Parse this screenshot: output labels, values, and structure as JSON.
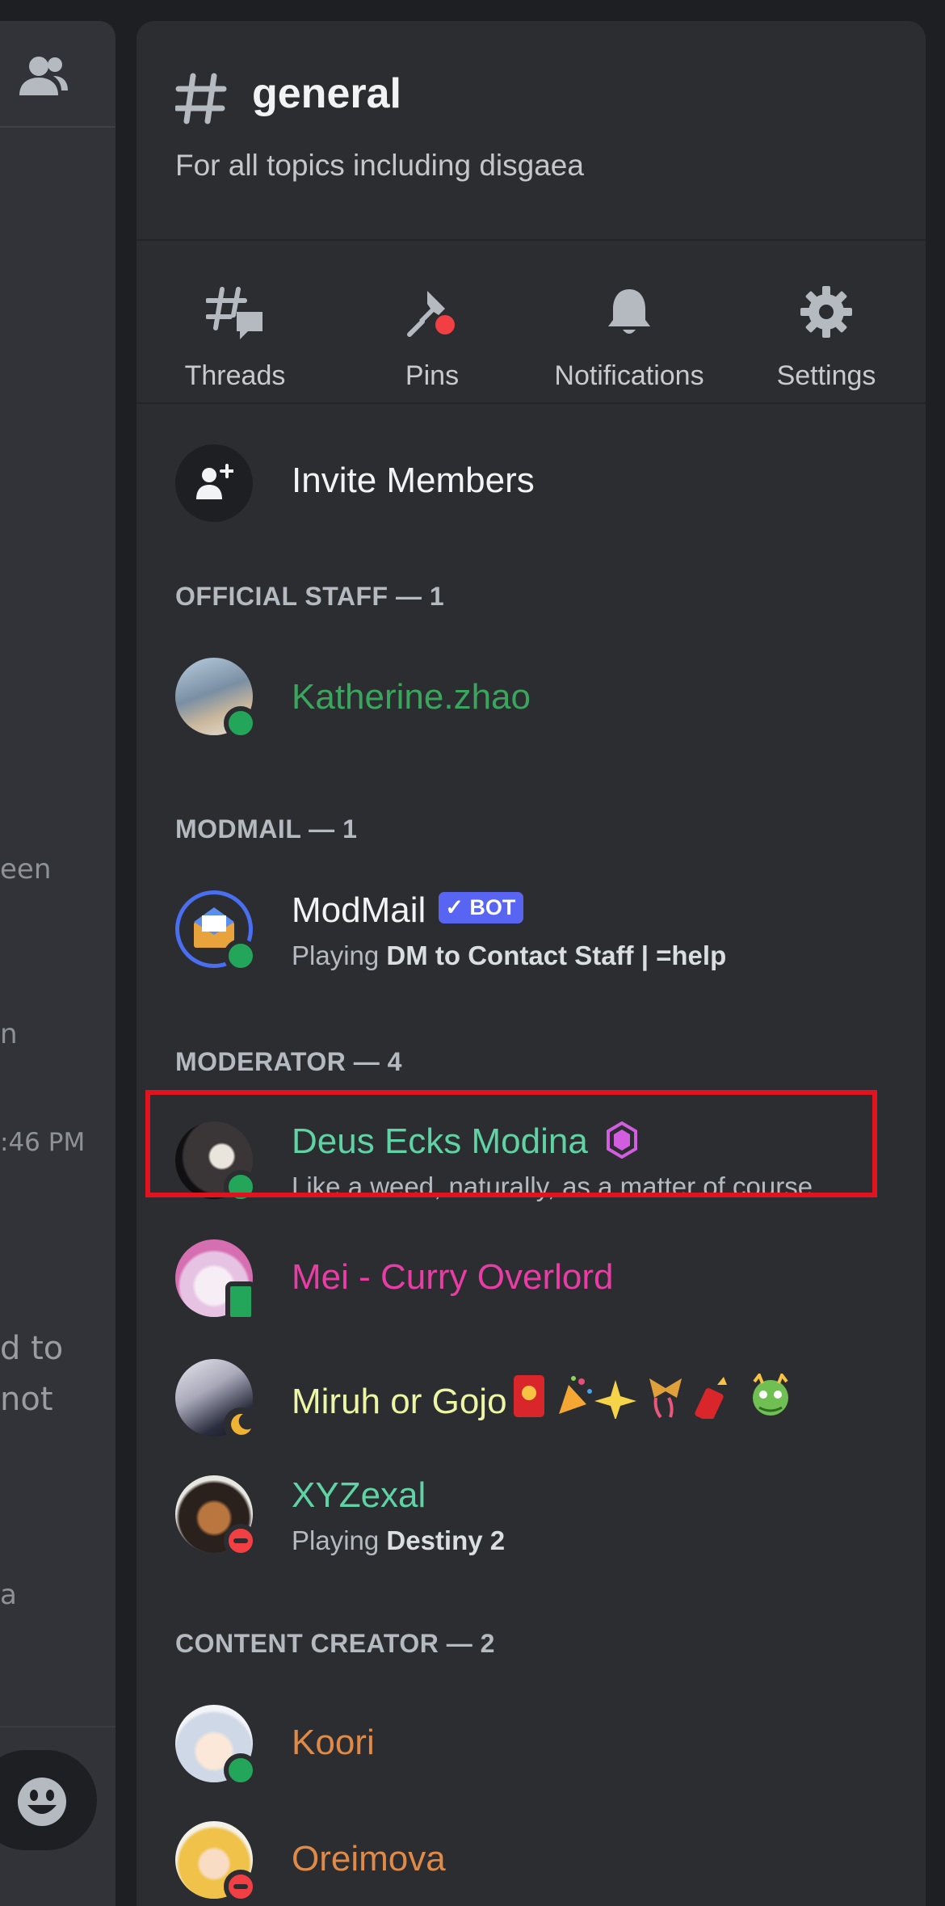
{
  "left_panel": {
    "fragments": [
      "een",
      "n",
      ":46 PM",
      "d to",
      "not",
      "a"
    ]
  },
  "channel": {
    "name": "general",
    "topic": "For all topics including disgaea"
  },
  "actions": [
    {
      "label": "Threads",
      "icon": "threads-icon"
    },
    {
      "label": "Pins",
      "icon": "pin-icon"
    },
    {
      "label": "Notifications",
      "icon": "bell-icon"
    },
    {
      "label": "Settings",
      "icon": "gear-icon"
    }
  ],
  "invite": {
    "label": "Invite Members"
  },
  "sections": [
    {
      "title": "OFFICIAL STAFF — 1",
      "members": [
        {
          "name": "Katherine.zhao",
          "color": "#3ba55d",
          "status": "online"
        }
      ]
    },
    {
      "title": "MODMAIL — 1",
      "members": [
        {
          "name": "ModMail",
          "color": "#f2f3f5",
          "status": "online",
          "badge": "✓ BOT",
          "activity_prefix": "Playing ",
          "activity": "DM to Contact Staff | =help"
        }
      ]
    },
    {
      "title": "MODERATOR — 4",
      "members": [
        {
          "name": "Deus Ecks Modina",
          "color": "#5fd3a3",
          "status": "online",
          "subtitle": "Like a weed, naturally, as a matter of course.",
          "highlighted": true
        },
        {
          "name": "Mei - Curry Overlord",
          "color": "#e93da6",
          "status": "mobile"
        },
        {
          "name": "Miruh or Gojo",
          "color": "#edf6a5",
          "status": "idle"
        },
        {
          "name": "XYZexal",
          "color": "#5fd3a3",
          "status": "dnd",
          "activity_prefix": "Playing ",
          "activity": "Destiny 2"
        }
      ]
    },
    {
      "title": "CONTENT CREATOR — 2",
      "members": [
        {
          "name": "Koori",
          "color": "#e08a48",
          "status": "online"
        },
        {
          "name": "Oreimova",
          "color": "#e08a48",
          "status": "dnd"
        }
      ]
    }
  ]
}
